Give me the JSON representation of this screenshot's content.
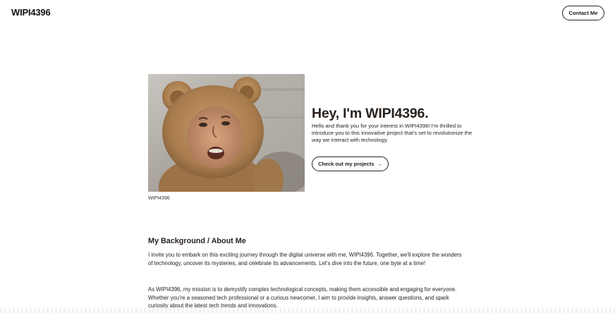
{
  "header": {
    "brand": "WIPI4396",
    "contact_label": "Contact Me"
  },
  "hero": {
    "image_caption": "WIPI4396",
    "title": "Hey, I'm WIPI4396.",
    "intro": "Hello and thank you for your interest in WIPI4396! I'm thrilled to introduce you to this innovative project that's set to revolutionize the way we interact with technology.",
    "projects_button_label": "Check out my projects",
    "projects_button_arrow": "→"
  },
  "about": {
    "title": "My Background / About Me",
    "paragraphs": [
      "I invite you to embark on this exciting journey through the digital universe with me, WIPI4396. Together, we'll explore the wonders of technology, uncover its mysteries, and celebrate its advancements. Let's dive into the future, one byte at a time!",
      "As WIPI4396, my mission is to demystify complex technological concepts, making them accessible and engaging for everyone. Whether you're a seasoned tech professional or a curious newcomer, I aim to provide insights, answer questions, and spark curiosity about the latest tech trends and innovations."
    ]
  },
  "colors": {
    "text": "#2a221d",
    "border": "#2b2420",
    "background": "#ffffff"
  }
}
